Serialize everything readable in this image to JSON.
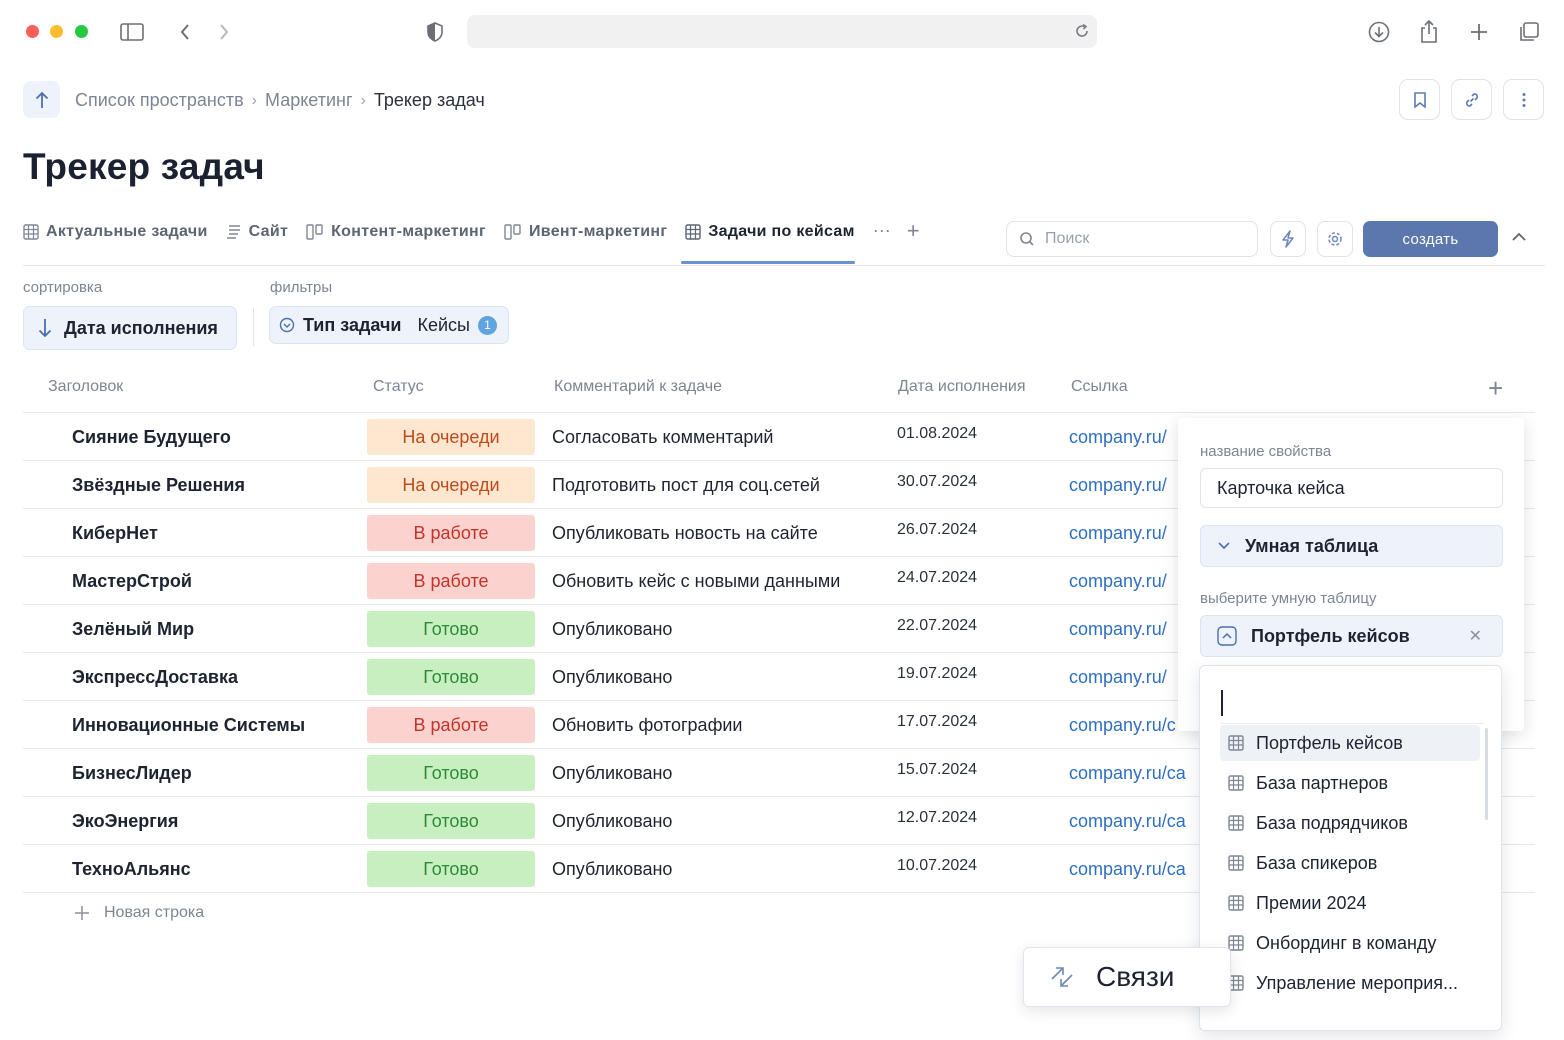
{
  "breadcrumbs": [
    "Список пространств",
    "Маркетинг",
    "Трекер задач"
  ],
  "page_title": "Трекер задач",
  "tabs": [
    {
      "label": "Актуальные задачи",
      "icon": "table-icon"
    },
    {
      "label": "Сайт",
      "icon": "list-icon"
    },
    {
      "label": "Контент-маркетинг",
      "icon": "kanban-icon"
    },
    {
      "label": "Ивент-маркетинг",
      "icon": "kanban-icon"
    },
    {
      "label": "Задачи по кейсам",
      "icon": "table-icon",
      "active": true
    }
  ],
  "tab_more": "···",
  "search": {
    "placeholder": "Поиск"
  },
  "create_label": "создать",
  "sort": {
    "label": "сортировка",
    "value": "Дата исполнения"
  },
  "filters": {
    "label": "фильтры",
    "name": "Тип задачи",
    "value": "Кейсы",
    "count": "1"
  },
  "columns": [
    "Заголовок",
    "Статус",
    "Комментарий к задаче",
    "Дата исполнения",
    "Ссылка"
  ],
  "rows": [
    {
      "title": "Сияние Будущего",
      "status": "На очереди",
      "comment": "Согласовать комментарий",
      "date": "01.08.2024",
      "link": "company.ru/"
    },
    {
      "title": "Звёздные Решения",
      "status": "На очереди",
      "comment": "Подготовить пост для соц.сетей",
      "date": "30.07.2024",
      "link": "company.ru/"
    },
    {
      "title": "КиберНет",
      "status": "В работе",
      "comment": "Опубликовать новость на сайте",
      "date": "26.07.2024",
      "link": "company.ru/"
    },
    {
      "title": "МастерСтрой",
      "status": "В работе",
      "comment": "Обновить кейс с новыми данными",
      "date": "24.07.2024",
      "link": "company.ru/"
    },
    {
      "title": "Зелёный Мир",
      "status": "Готово",
      "comment": "Опубликовано",
      "date": "22.07.2024",
      "link": "company.ru/"
    },
    {
      "title": "ЭкспрессДоставка",
      "status": "Готово",
      "comment": "Опубликовано",
      "date": "19.07.2024",
      "link": "company.ru/"
    },
    {
      "title": "Инновационные Системы",
      "status": "В работе",
      "comment": "Обновить фотографии",
      "date": "17.07.2024",
      "link": "company.ru/c"
    },
    {
      "title": "БизнесЛидер",
      "status": "Готово",
      "comment": "Опубликовано",
      "date": "15.07.2024",
      "link": "company.ru/ca"
    },
    {
      "title": "ЭкоЭнергия",
      "status": "Готово",
      "comment": "Опубликовано",
      "date": "12.07.2024",
      "link": "company.ru/ca"
    },
    {
      "title": "ТехноАльянс",
      "status": "Готово",
      "comment": "Опубликовано",
      "date": "10.07.2024",
      "link": "company.ru/ca"
    }
  ],
  "status_colors": {
    "На очереди": {
      "bg": "#fde8cf",
      "fg": "#c0491d"
    },
    "В работе": {
      "bg": "#fbd2cd",
      "fg": "#c4332a"
    },
    "Готово": {
      "bg": "#c8efc0",
      "fg": "#2f8a3a"
    }
  },
  "new_row_label": "Новая строка",
  "property_panel": {
    "name_label": "название свойства",
    "name_value": "Карточка кейса",
    "type_value": "Умная таблица",
    "choose_label": "выберите умную таблицу",
    "selected_table": "Портфель кейсов"
  },
  "dropdown": {
    "items": [
      "Портфель кейсов",
      "База партнеров",
      "База подрядчиков",
      "База спикеров",
      "Премии 2024",
      "Онбординг в команду",
      "Управление мероприя..."
    ]
  },
  "links_label": "Связи",
  "accent_color": "#5b77ad"
}
